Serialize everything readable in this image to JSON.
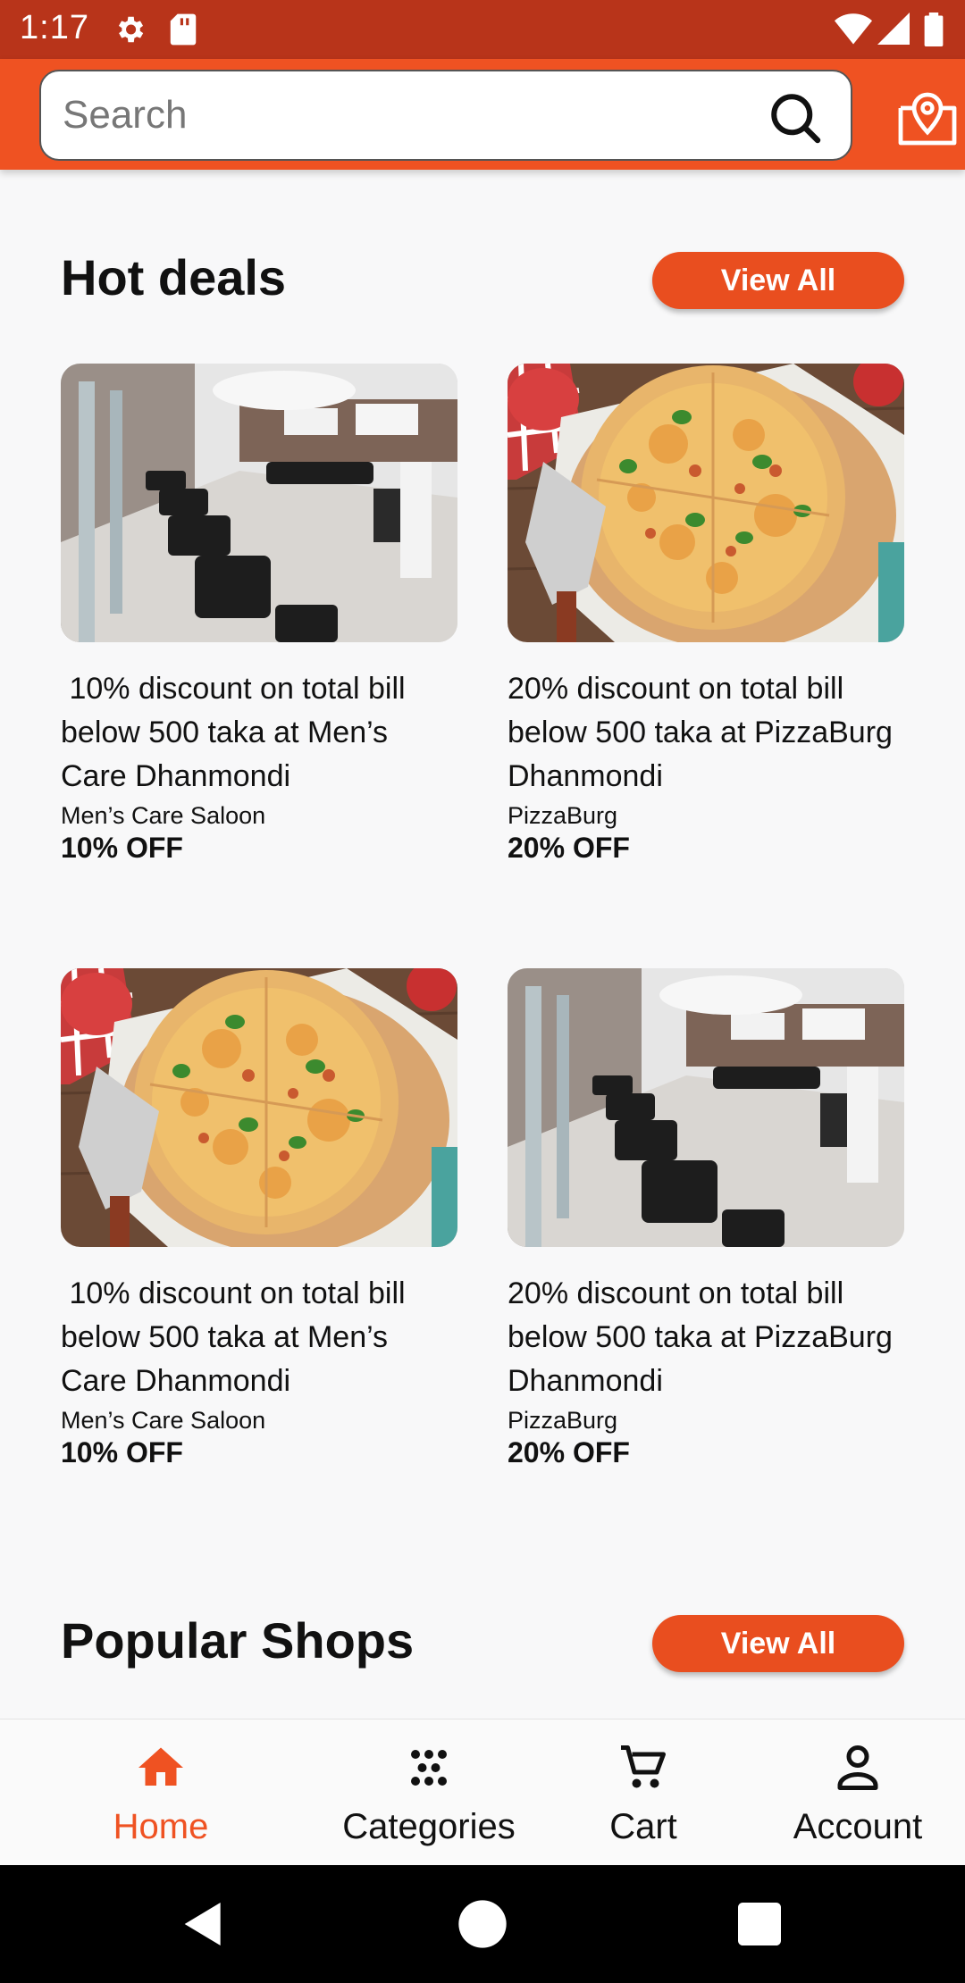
{
  "status_bar": {
    "time": "1:17"
  },
  "search": {
    "placeholder": "Search"
  },
  "hot_deals": {
    "title": "Hot deals",
    "view_all_label": "View All",
    "deals": [
      {
        "title": " 10% discount on total bill below 500 taka at Men’s Care Dhanmondi",
        "shop": "Men’s Care Saloon",
        "discount": "10% OFF",
        "image": "salon"
      },
      {
        "title": "20% discount on total bill below 500 taka at PizzaBurg Dhanmondi",
        "shop": "PizzaBurg",
        "discount": "20% OFF",
        "image": "pizza"
      },
      {
        "title": " 10% discount on total bill below 500 taka at Men’s Care Dhanmondi",
        "shop": "Men’s Care Saloon",
        "discount": "10% OFF",
        "image": "pizza"
      },
      {
        "title": "20% discount on total bill below 500 taka at PizzaBurg Dhanmondi",
        "shop": "PizzaBurg",
        "discount": "20% OFF",
        "image": "salon"
      }
    ]
  },
  "popular_shops": {
    "title": "Popular Shops",
    "view_all_label": "View All"
  },
  "bottom_nav": {
    "items": [
      {
        "label": "Home",
        "icon": "home-icon",
        "active": true
      },
      {
        "label": "Categories",
        "icon": "categories-icon",
        "active": false
      },
      {
        "label": "Cart",
        "icon": "cart-icon",
        "active": false
      },
      {
        "label": "Account",
        "icon": "account-icon",
        "active": false
      }
    ]
  },
  "colors": {
    "status_bar": "#b8341a",
    "primary": "#ef5222",
    "button": "#e94e1f",
    "background": "#f8f8f9"
  }
}
